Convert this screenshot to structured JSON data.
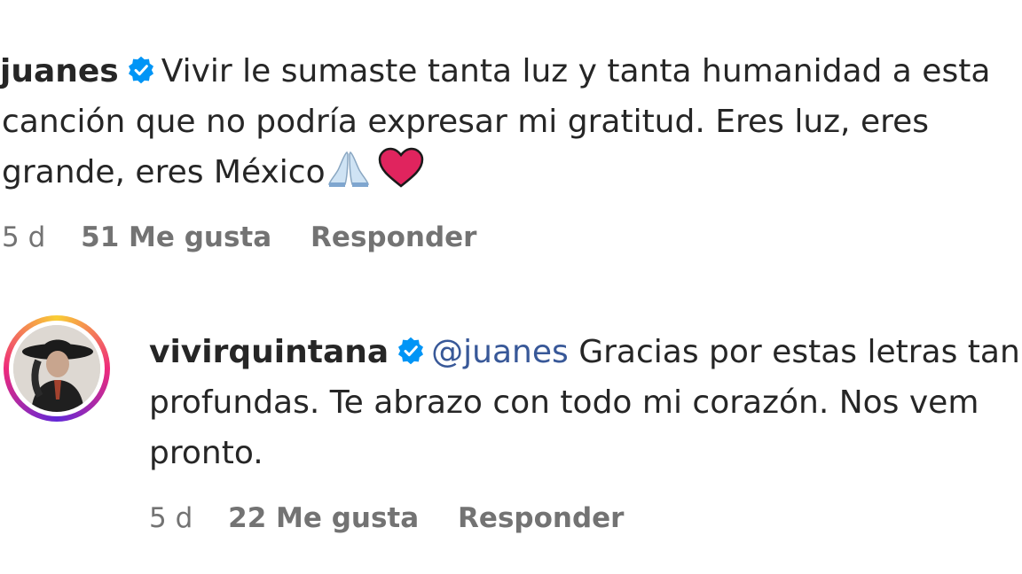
{
  "comment1": {
    "username": "juanes",
    "line1": "Vivir le sumaste tanta luz y tanta humanidad a esta",
    "line2": "canción que no podría expresar mi gratitud. Eres luz, eres",
    "line3": "grande, eres México",
    "time": "5 d",
    "likes": "51 Me gusta",
    "reply": "Responder"
  },
  "comment2": {
    "username": "vivirquintana",
    "mention": "@juanes",
    "line1": "Gracias por estas letras tan",
    "line2": "profundas. Te abrazo con todo mi corazón. Nos vem",
    "line3": "pronto.",
    "time": "5 d",
    "likes": "22 Me gusta",
    "reply": "Responder"
  },
  "colors": {
    "verified": "#0095f6",
    "mention": "#385898",
    "meta": "#737373",
    "heart": "#e0245e"
  },
  "icons": [
    "verified-badge-icon",
    "praying-hands-emoji",
    "red-heart-emoji",
    "profile-avatar"
  ]
}
